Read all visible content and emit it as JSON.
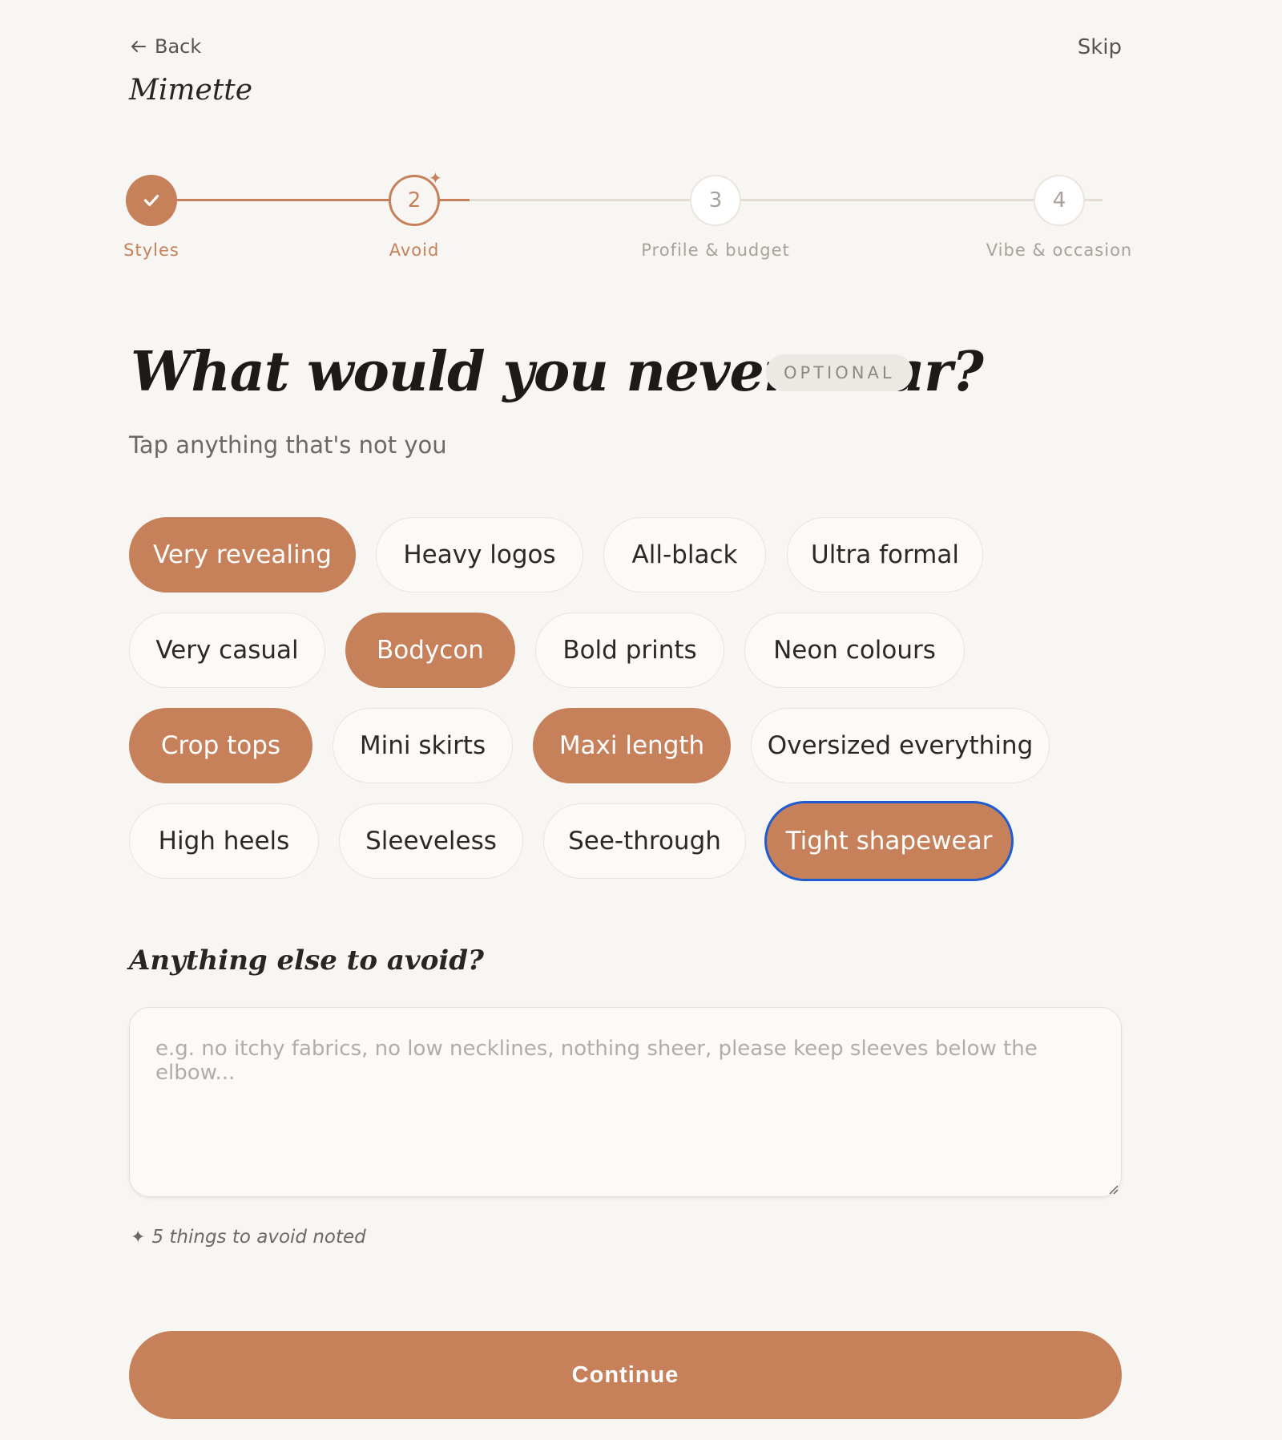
{
  "nav": {
    "back_label": "Back",
    "skip_label": "Skip",
    "brand": "Mimette"
  },
  "stepper": {
    "steps": [
      {
        "number": "",
        "label": "Styles",
        "state": "complete"
      },
      {
        "number": "2",
        "label": "Avoid",
        "state": "current"
      },
      {
        "number": "3",
        "label": "Profile & budget",
        "state": "todo"
      },
      {
        "number": "4",
        "label": "Vibe & occasion",
        "state": "todo"
      }
    ]
  },
  "heading": {
    "title": "What would you never wear?",
    "badge": "OPTIONAL",
    "subtitle": "Tap anything that's not you"
  },
  "chips": [
    {
      "label": "Very revealing",
      "selected": true
    },
    {
      "label": "Heavy logos",
      "selected": false
    },
    {
      "label": "All-black",
      "selected": false
    },
    {
      "label": "Ultra formal",
      "selected": false
    },
    {
      "label": "Very casual",
      "selected": false
    },
    {
      "label": "Bodycon",
      "selected": true
    },
    {
      "label": "Bold prints",
      "selected": false
    },
    {
      "label": "Neon colours",
      "selected": false
    },
    {
      "label": "Crop tops",
      "selected": true
    },
    {
      "label": "Mini skirts",
      "selected": false
    },
    {
      "label": "Maxi length",
      "selected": true
    },
    {
      "label": "Oversized everything",
      "selected": false
    },
    {
      "label": "High heels",
      "selected": false
    },
    {
      "label": "Sleeveless",
      "selected": false
    },
    {
      "label": "See-through",
      "selected": false
    },
    {
      "label": "Tight shapewear",
      "selected": true,
      "focused": true
    }
  ],
  "extra": {
    "heading": "Anything else to avoid?",
    "value": "",
    "placeholder": "e.g. no itchy fabrics, no low necklines, nothing sheer, please keep sleeves below the elbow..."
  },
  "note": {
    "text": "5 things to avoid noted"
  },
  "continue_label": "Continue",
  "colors": {
    "accent": "#c6805a",
    "background": "#f8f6f3",
    "focus_ring": "#1f5bd1"
  }
}
